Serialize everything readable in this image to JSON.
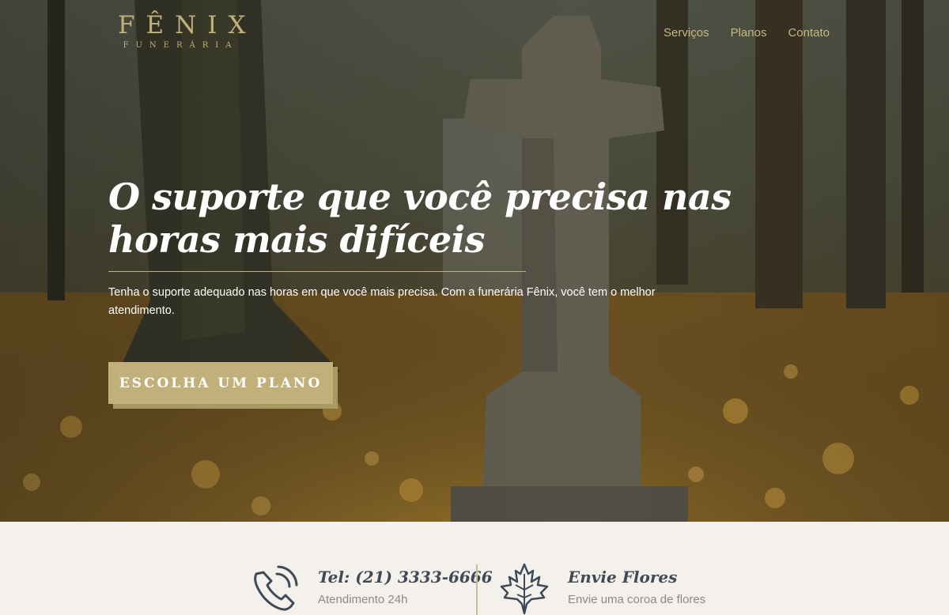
{
  "brand": {
    "name": "FÊNIX",
    "subtitle": "FUNERÁRIA"
  },
  "nav": {
    "items": [
      {
        "label": "Serviços"
      },
      {
        "label": "Planos"
      },
      {
        "label": "Contato"
      }
    ]
  },
  "hero": {
    "headline": "O suporte que você precisa nas horas mais difíceis",
    "lead": "Tenha o suporte adequado nas horas em que você mais precisa. Com a funerária Fênix, você tem o melhor atendimento.",
    "cta_label": "ESCOLHA UM PLANO"
  },
  "info": {
    "phone": {
      "title": "Tel: (21) 3333-6666",
      "desc": "Atendimento 24h",
      "icon": "phone-icon"
    },
    "flowers": {
      "title": "Envie Flores",
      "desc": "Envie uma coroa de flores",
      "icon": "maple-leaf-icon"
    }
  },
  "colors": {
    "accent": "#c2b07a",
    "dark_text": "#3f4a56",
    "muted_text": "#8a8a8a",
    "strip_bg": "#f4f1ec"
  }
}
